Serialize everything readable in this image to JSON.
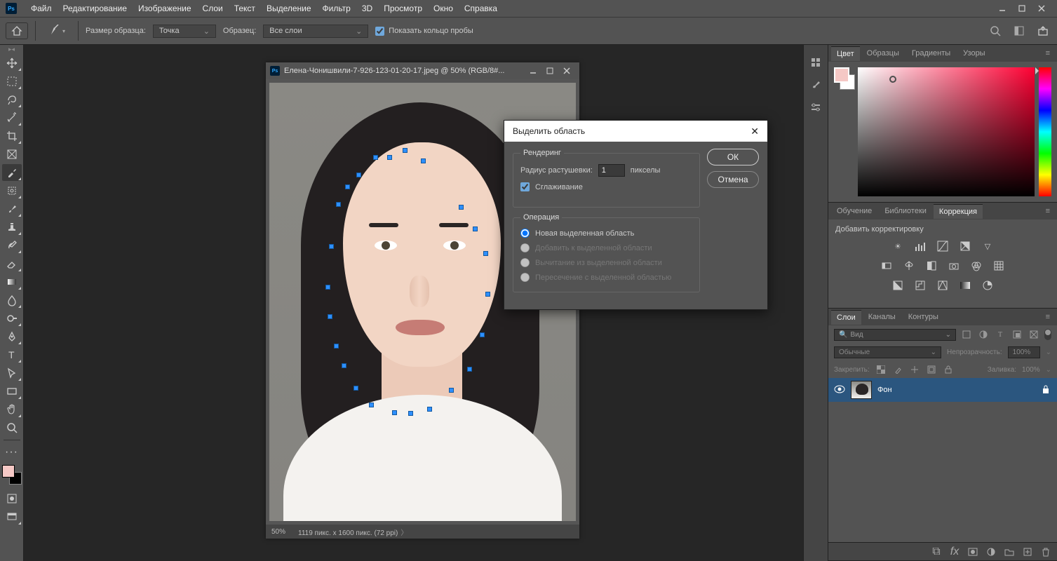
{
  "app": {
    "name": "Ps"
  },
  "menubar": {
    "items": [
      "Файл",
      "Редактирование",
      "Изображение",
      "Слои",
      "Текст",
      "Выделение",
      "Фильтр",
      "3D",
      "Просмотр",
      "Окно",
      "Справка"
    ]
  },
  "optionsbar": {
    "sample_size_label": "Размер образца:",
    "sample_size_value": "Точка",
    "sample_label": "Образец:",
    "sample_value": "Все слои",
    "show_ring": "Показать кольцо пробы"
  },
  "document": {
    "title": "Елена-Чонишвили-7-926-123-01-20-17.jpeg @ 50% (RGB/8#...",
    "status_zoom": "50%",
    "status_dims": "1119 пикс. x 1600 пикс. (72 ppi)"
  },
  "dialog": {
    "title": "Выделить область",
    "fieldset_render": "Рендеринг",
    "feather_label": "Радиус растушевки:",
    "feather_value": "1",
    "feather_unit": "пикселы",
    "antialias": "Сглаживание",
    "fieldset_op": "Операция",
    "op_new": "Новая выделенная область",
    "op_add": "Добавить к выделенной области",
    "op_sub": "Вычитание из выделенной области",
    "op_int": "Пересечение с выделенной областью",
    "ok": "ОК",
    "cancel": "Отмена"
  },
  "panels": {
    "color_tabs": [
      "Цвет",
      "Образцы",
      "Градиенты",
      "Узоры"
    ],
    "mid_tabs": [
      "Обучение",
      "Библиотеки",
      "Коррекция"
    ],
    "mid_label": "Добавить корректировку",
    "layers_tabs": [
      "Слои",
      "Каналы",
      "Контуры"
    ],
    "layers": {
      "search_placeholder": "Вид",
      "blend_mode": "Обычные",
      "opacity_label": "Непрозрачность:",
      "opacity_value": "100%",
      "lock_label": "Закрепить:",
      "fill_label": "Заливка:",
      "fill_value": "100%",
      "layer0_name": "Фон"
    }
  }
}
